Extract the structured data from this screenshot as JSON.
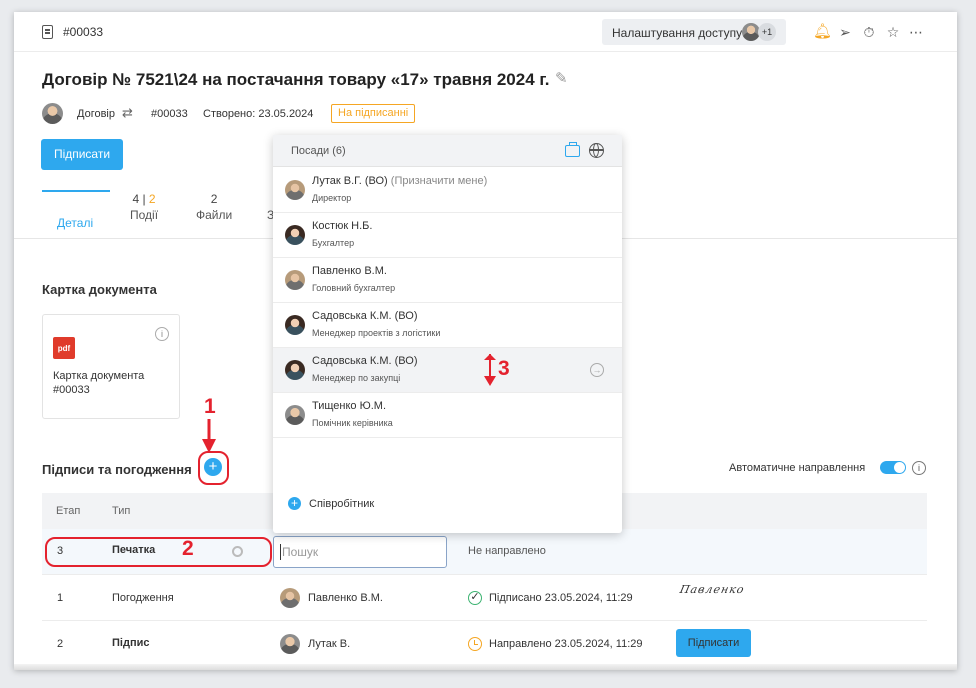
{
  "topbar": {
    "doc_id": "#00033",
    "access_button": "Налаштування доступу",
    "access_more": "+1"
  },
  "title": "Договір № 7521\\24 на постачання товару «17» травня 2024 г.",
  "meta": {
    "type": "Договір",
    "number": "#00033",
    "created": "Створено: 23.05.2024",
    "status": "На підписанні"
  },
  "sign_button": "Підписати",
  "tabs": [
    {
      "label": "Деталі"
    },
    {
      "count": "4",
      "count_orange": "2",
      "label": "Події"
    },
    {
      "count": "2",
      "label": "Файли"
    },
    {
      "label": "З"
    }
  ],
  "doc_card": {
    "section_title": "Картка документа",
    "file_name": "Картка документа #00033",
    "file_type": "pdf"
  },
  "signatures": {
    "section_title": "Підписи та погодження",
    "auto_label": "Автоматичне направлення",
    "columns": [
      "Етап",
      "Тип"
    ],
    "rows": [
      {
        "stage": "3",
        "type": "Печатка",
        "status": "Не направлено"
      },
      {
        "stage": "1",
        "type": "Погодження",
        "person": "Павленко В.М.",
        "status": "Підписано 23.05.2024, 11:29",
        "signature": "Павленко"
      },
      {
        "stage": "2",
        "type": "Підпис",
        "person": "Лутак В.",
        "status": "Направлено 23.05.2024, 11:29",
        "button": "Підписати"
      }
    ],
    "search_placeholder": "Пошук"
  },
  "dropdown": {
    "header": "Посади (6)",
    "items": [
      {
        "name": "Лутак В.Г. (ВО)",
        "hint": "(Призначити мене)",
        "role": "Директор"
      },
      {
        "name": "Костюк Н.Б.",
        "role": "Бухгалтер"
      },
      {
        "name": "Павленко В.М.",
        "role": "Головний бухгалтер"
      },
      {
        "name": "Садовська К.М. (ВО)",
        "role": "Менеджер проектів з логістики"
      },
      {
        "name": "Садовська К.М. (ВО)",
        "role": "Менеджер по закупці"
      },
      {
        "name": "Тищенко Ю.М.",
        "role": "Помічник керівника"
      }
    ],
    "employee_label": "Співробітник"
  },
  "annotations": {
    "one": "1",
    "two": "2",
    "three": "3"
  },
  "colors": {
    "accent": "#2ea8ee",
    "warning": "#f5a623",
    "annotation": "#e4222e",
    "success": "#3cb371"
  }
}
